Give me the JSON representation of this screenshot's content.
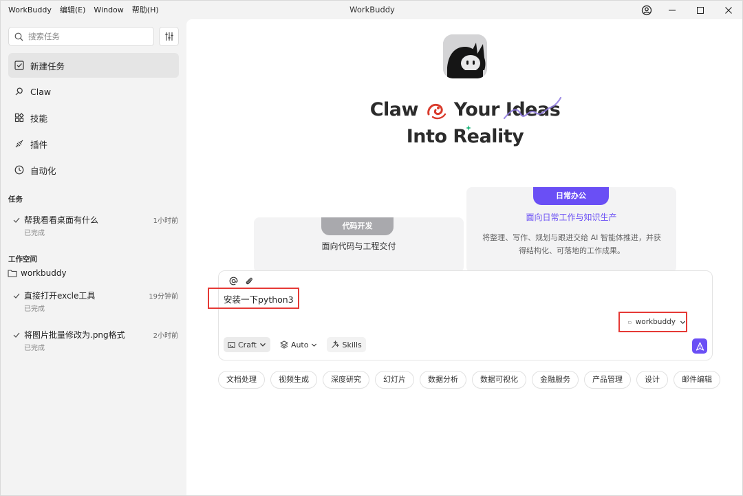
{
  "titlebar": {
    "title": "WorkBuddy",
    "menu": [
      "WorkBuddy",
      "编辑(E)",
      "Window",
      "帮助(H)"
    ]
  },
  "sidebar": {
    "search_placeholder": "搜索任务",
    "nav": [
      {
        "label": "新建任务",
        "icon": "new-task-icon",
        "active": true
      },
      {
        "label": "Claw",
        "icon": "claw-icon"
      },
      {
        "label": "技能",
        "icon": "skills-icon"
      },
      {
        "label": "插件",
        "icon": "plugin-icon"
      },
      {
        "label": "自动化",
        "icon": "clock-icon"
      }
    ],
    "tasks_title": "任务",
    "tasks": [
      {
        "name": "帮我看看桌面有什么",
        "time": "1小时前",
        "status": "已完成"
      }
    ],
    "workspace_title": "工作空间",
    "workspace_name": "workbuddy",
    "workspace_tasks": [
      {
        "name": "直接打开excle工具",
        "time": "19分钟前",
        "status": "已完成"
      },
      {
        "name": "将图片批量修改为.png格式",
        "time": "2小时前",
        "status": "已完成"
      }
    ]
  },
  "hero": {
    "line1_a": "Claw",
    "line1_b": "Your",
    "line1_c": "Ideas",
    "line2": "Into Reality"
  },
  "cards": {
    "left": {
      "tag": "代码开发",
      "subtitle": "面向代码与工程交付"
    },
    "right": {
      "tag": "日常办公",
      "subtitle": "面向日常工作与知识生产",
      "description": "将整理、写作、规划与跟进交给 AI 智能体推进，并获得结构化、可落地的工作成果。"
    }
  },
  "composer": {
    "input_text": "安装一下python3",
    "mode": "Craft",
    "model": "Auto",
    "skills": "Skills",
    "workspace": "workbuddy"
  },
  "chips": [
    "文档处理",
    "视频生成",
    "深度研究",
    "幻灯片",
    "数据分析",
    "数据可视化",
    "金融服务",
    "产品管理",
    "设计",
    "邮件编辑"
  ],
  "colors": {
    "accent": "#6a4ff5",
    "highlight": "#e53935",
    "sidebar_bg": "#f3f3f3"
  }
}
